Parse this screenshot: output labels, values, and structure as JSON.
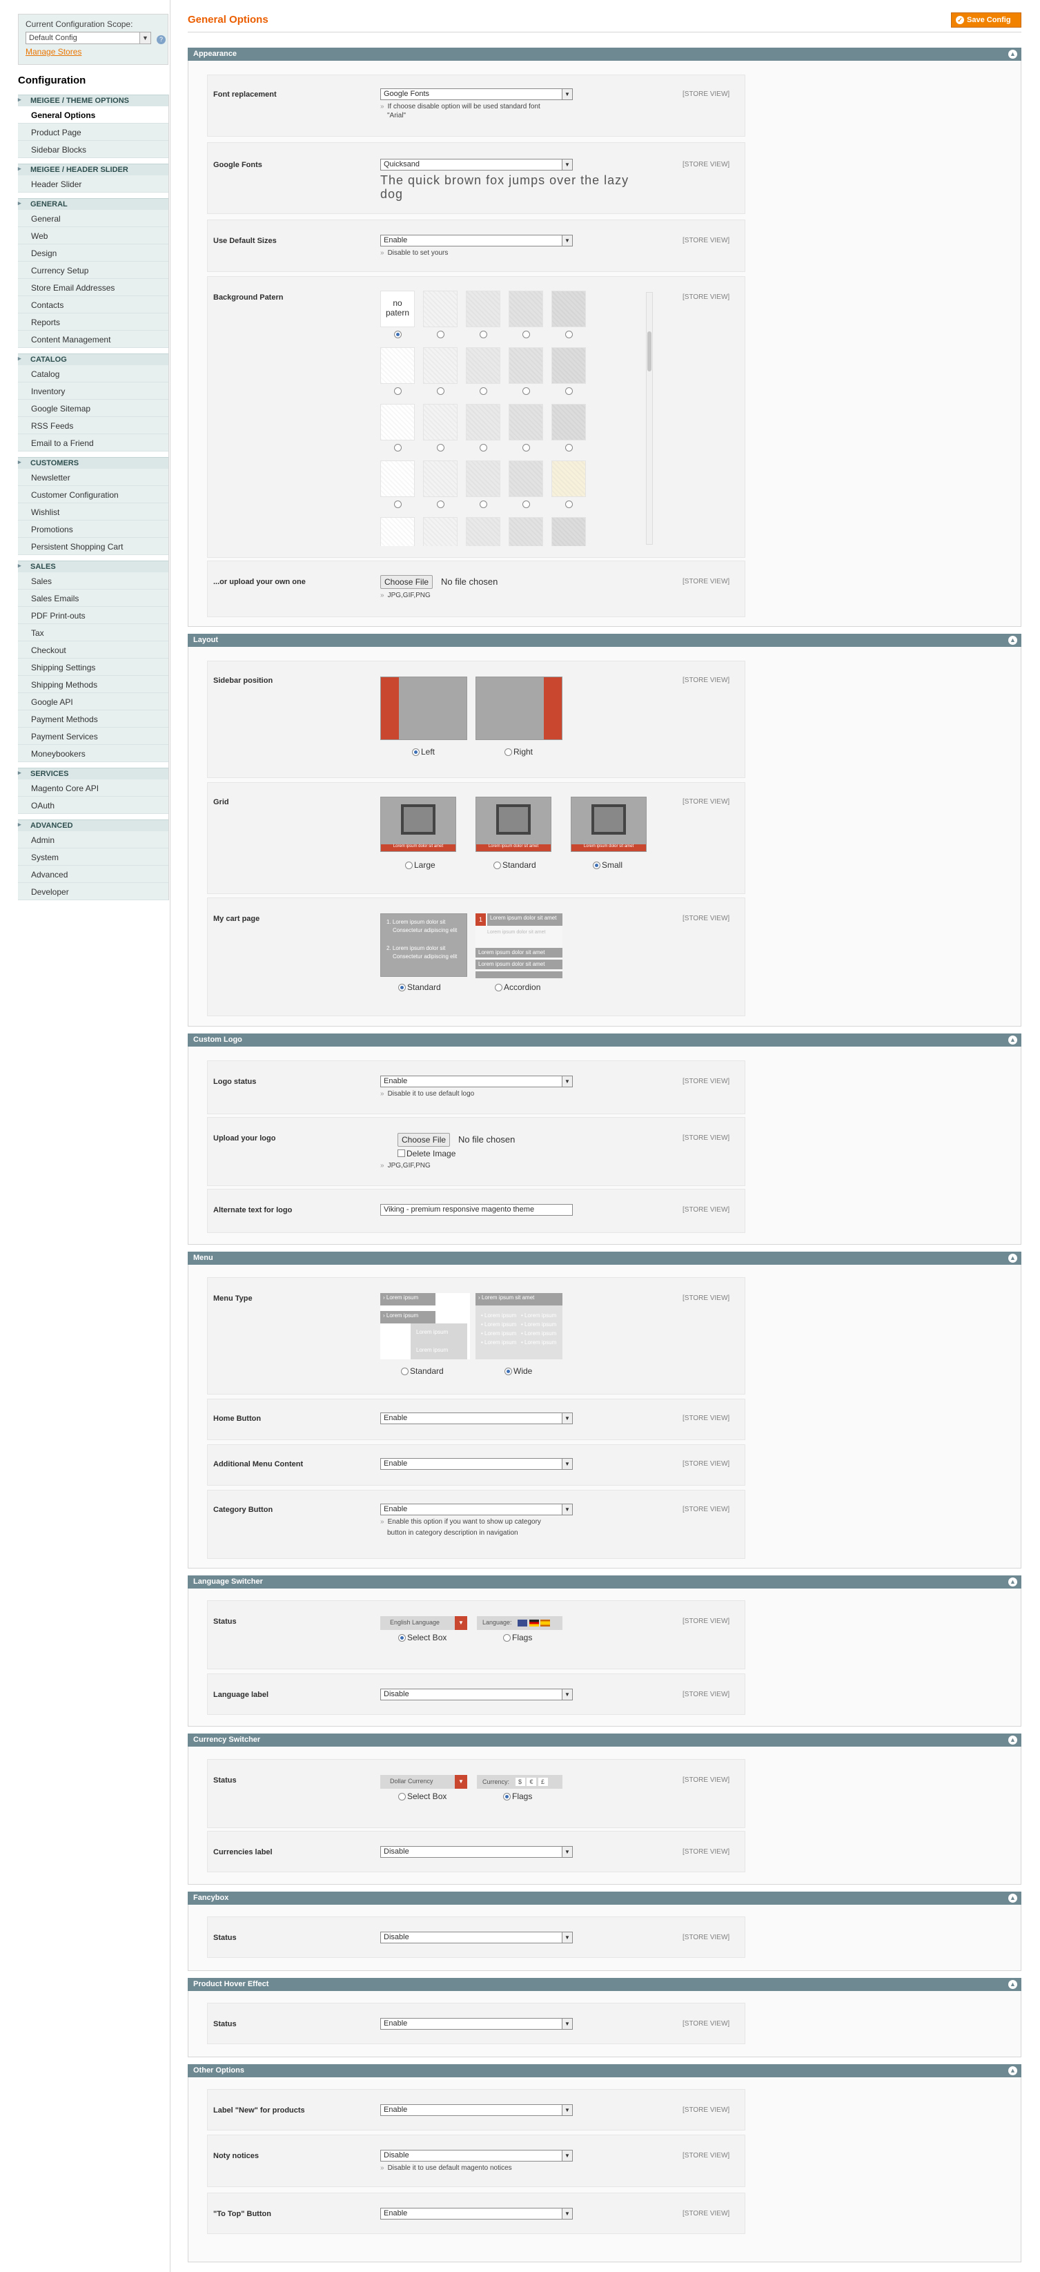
{
  "scope": {
    "label": "Current Configuration Scope:",
    "value": "Default Config",
    "manage": "Manage Stores"
  },
  "sidebar": {
    "title": "Configuration",
    "sections": [
      {
        "title": "Meigee / Theme Options",
        "items": [
          "General Options",
          "Product Page",
          "Sidebar Blocks"
        ]
      },
      {
        "title": "Meigee / Header Slider",
        "items": [
          "Header Slider"
        ]
      },
      {
        "title": "General",
        "items": [
          "General",
          "Web",
          "Design",
          "Currency Setup",
          "Store Email Addresses",
          "Contacts",
          "Reports",
          "Content Management"
        ]
      },
      {
        "title": "Catalog",
        "items": [
          "Catalog",
          "Inventory",
          "Google Sitemap",
          "RSS Feeds",
          "Email to a Friend"
        ]
      },
      {
        "title": "Customers",
        "items": [
          "Newsletter",
          "Customer Configuration",
          "Wishlist",
          "Promotions",
          "Persistent Shopping Cart"
        ]
      },
      {
        "title": "Sales",
        "items": [
          "Sales",
          "Sales Emails",
          "PDF Print-outs",
          "Tax",
          "Checkout",
          "Shipping Settings",
          "Shipping Methods",
          "Google API",
          "Payment Methods",
          "Payment Services",
          "Moneybookers"
        ]
      },
      {
        "title": "Services",
        "items": [
          "Magento Core API",
          "OAuth"
        ]
      },
      {
        "title": "Advanced",
        "items": [
          "Admin",
          "System",
          "Advanced",
          "Developer"
        ]
      }
    ]
  },
  "header": {
    "title": "General Options",
    "save": "Save Config"
  },
  "store_view": "[STORE VIEW]",
  "appearance": {
    "title": "Appearance",
    "font_repl": {
      "label": "Font replacement",
      "value": "Google Fonts",
      "note1": "If choose disable option will be used standard font",
      "note2": "\"Arial\""
    },
    "google_fonts": {
      "label": "Google Fonts",
      "value": "Quicksand",
      "preview": "The quick brown fox jumps over the lazy dog"
    },
    "default_sizes": {
      "label": "Use Default Sizes",
      "value": "Enable",
      "note": "Disable to set yours"
    },
    "bg": {
      "label": "Background Patern",
      "nopatern": "no patern"
    },
    "upload": {
      "label": "...or upload your own one",
      "button": "Choose File",
      "status": "No file chosen",
      "note": "JPG,GIF,PNG"
    }
  },
  "layout": {
    "title": "Layout",
    "sidebar": {
      "label": "Sidebar position",
      "left": "Left",
      "right": "Right"
    },
    "grid": {
      "label": "Grid",
      "large": "Large",
      "standard": "Standard",
      "small": "Small",
      "strip": "Lorem ipsum dolor sit amet"
    },
    "cart": {
      "label": "My cart page",
      "standard": "Standard",
      "accordion": "Accordion",
      "item1": "1. Lorem ipsum dolor sit",
      "item1b": "Consectetur adipiscing elit",
      "item2": "2. Lorem ipsum dolor sit",
      "item2b": "Consectetur adipiscing elit",
      "acc": "Lorem ipsum dolor sit amet"
    }
  },
  "logo": {
    "title": "Custom Logo",
    "status": {
      "label": "Logo status",
      "value": "Enable",
      "note": "Disable it to use default logo"
    },
    "upload": {
      "label": "Upload your logo",
      "button": "Choose File",
      "status": "No file chosen",
      "delete": "Delete Image",
      "note": "JPG,GIF,PNG"
    },
    "alt": {
      "label": "Alternate text for logo",
      "value": "Viking - premium responsive magento  theme"
    }
  },
  "menu": {
    "title": "Menu",
    "type": {
      "label": "Menu Type",
      "standard": "Standard",
      "wide": "Wide",
      "lorem": "Lorem ipsum",
      "wide_head": "Lorem ipsum sit amet"
    },
    "home": {
      "label": "Home Button",
      "value": "Enable"
    },
    "additional": {
      "label": "Additional Menu Content",
      "value": "Enable"
    },
    "category": {
      "label": "Category Button",
      "value": "Enable",
      "note1": "Enable this option if you want to show up category",
      "note2": "button in category description in navigation"
    }
  },
  "lang": {
    "title": "Language Switcher",
    "status": {
      "label": "Status",
      "selectbox": "Select Box",
      "flags": "Flags",
      "sample": "English Language",
      "sample2": "Language:"
    },
    "label": {
      "label": "Language label",
      "value": "Disable"
    }
  },
  "currency": {
    "title": "Currency Switcher",
    "status": {
      "label": "Status",
      "selectbox": "Select Box",
      "flags": "Flags",
      "sample": "Dollar Currency",
      "sample2": "Currency:",
      "sym1": "$",
      "sym2": "€",
      "sym3": "£"
    },
    "label": {
      "label": "Currencies label",
      "value": "Disable"
    }
  },
  "fancybox": {
    "title": "Fancybox",
    "status": {
      "label": "Status",
      "value": "Disable"
    }
  },
  "hover": {
    "title": "Product Hover Effect",
    "status": {
      "label": "Status",
      "value": "Enable"
    }
  },
  "other": {
    "title": "Other Options",
    "new": {
      "label": "Label \"New\" for products",
      "value": "Enable"
    },
    "noty": {
      "label": "Noty notices",
      "value": "Disable",
      "note": "Disable it to use default magento notices"
    },
    "totop": {
      "label": "\"To Top\" Button",
      "value": "Enable"
    }
  },
  "colors": {
    "accent": "#eb5e00",
    "section": "#6f8992",
    "red": "#c9472f"
  }
}
